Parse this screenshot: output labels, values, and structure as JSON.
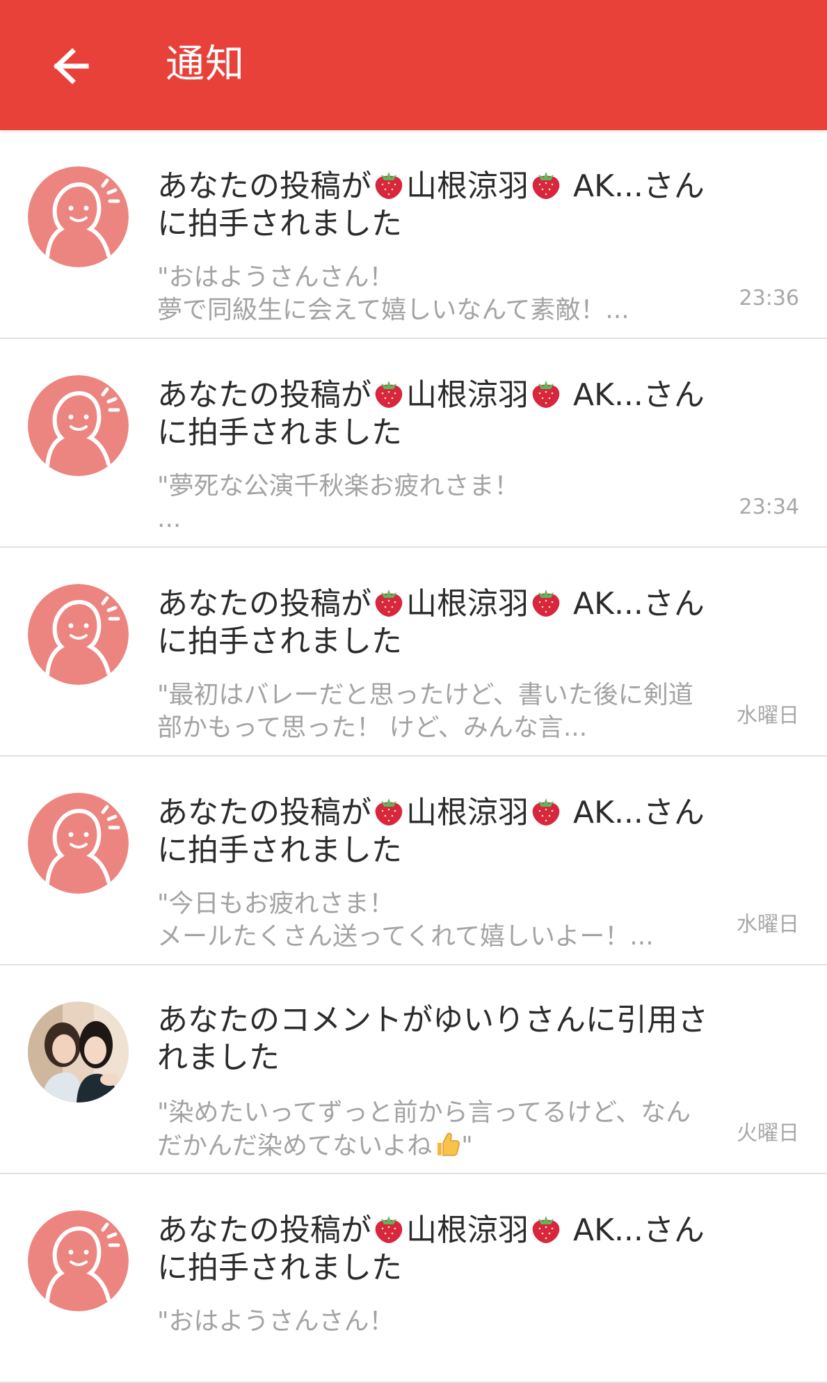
{
  "appbar": {
    "title": "通知",
    "back_icon": "arrow-left-icon",
    "color": "#e8413a"
  },
  "notifications": [
    {
      "title_prefix": "あなたの投稿が",
      "user_name": "山根涼羽",
      "title_suffix": " AK...さんに拍手されました",
      "body": "\"おはようさんさん！\n夢で同級生に会えて嬉しいなんて素敵！...",
      "time": "23:36",
      "avatar": "default-avatar-icon"
    },
    {
      "title_prefix": "あなたの投稿が",
      "user_name": "山根涼羽",
      "title_suffix": " AK...さんに拍手されました",
      "body": "\"夢死な公演千秋楽お疲れさま！\n...",
      "time": "23:34",
      "avatar": "default-avatar-icon"
    },
    {
      "title_prefix": "あなたの投稿が",
      "user_name": "山根涼羽",
      "title_suffix": " AK...さんに拍手されました",
      "body": "\"最初はバレーだと思ったけど、書いた後に剣道部かもって思った！ けど、みんな言...",
      "time": "水曜日",
      "avatar": "default-avatar-icon"
    },
    {
      "title_prefix": "あなたの投稿が",
      "user_name": "山根涼羽",
      "title_suffix": " AK...さんに拍手されました",
      "body": "\"今日もお疲れさま！\nメールたくさん送ってくれて嬉しいよー！...",
      "time": "水曜日",
      "avatar": "default-avatar-icon"
    },
    {
      "title": "あなたのコメントがゆいりさんに引用されました",
      "body_prefix": "\"染めたいってずっと前から言ってるけど、なんだかんだ染めてないよね",
      "body_suffix": "\"",
      "time": "火曜日",
      "avatar": "photo-avatar"
    },
    {
      "title_prefix": "あなたの投稿が",
      "user_name": "山根涼羽",
      "title_suffix": " AK...さんに拍手されました",
      "body": "\"おはようさんさん！",
      "time": "",
      "avatar": "default-avatar-icon"
    }
  ]
}
